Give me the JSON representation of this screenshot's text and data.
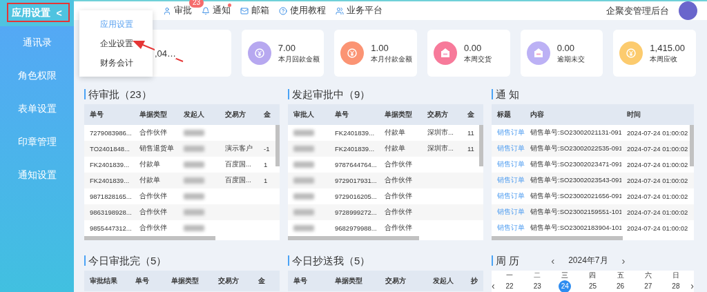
{
  "sidebar": {
    "title": "应用设置",
    "collapse_glyph": "<",
    "items": [
      {
        "label": "通讯录"
      },
      {
        "label": "角色权限"
      },
      {
        "label": "表单设置"
      },
      {
        "label": "印章管理"
      },
      {
        "label": "通知设置"
      }
    ]
  },
  "nav": [
    {
      "label": "审批",
      "badge": "23"
    },
    {
      "label": "通知",
      "dot": true
    },
    {
      "label": "邮箱"
    },
    {
      "label": "使用教程"
    },
    {
      "label": "业务平台"
    }
  ],
  "header_title": "企聚变管理后台",
  "dropdown": [
    {
      "label": "应用设置",
      "selected": true
    },
    {
      "label": "企业设置",
      "selected": false
    },
    {
      "label": "财务会计",
      "selected": false
    }
  ],
  "stats": [
    {
      "value": ",04…"
    },
    {
      "kind": "yen",
      "color": "#b7a8f0",
      "value": "7.00",
      "label": "本月回款金额"
    },
    {
      "kind": "yen",
      "color": "#fb9474",
      "value": "1.00",
      "label": "本月付款金额"
    },
    {
      "kind": "sale",
      "color": "#f77a9a",
      "value": "0.00",
      "label": "本周交货"
    },
    {
      "kind": "sale",
      "color": "#bcb1f5",
      "value": "0.00",
      "label": "逾期未交"
    },
    {
      "kind": "yen",
      "color": "#fccb6e",
      "value": "1,415.00",
      "label": "本周应收"
    }
  ],
  "panels": [
    {
      "title": "待审批（23）",
      "columns": [
        "单号",
        "单据类型",
        "发起人",
        "交易方",
        "金"
      ],
      "rows": [
        [
          "7279083986...",
          "合作伙伴",
          {
            "kind": "blurred"
          },
          "",
          ""
        ],
        [
          "TO2401848...",
          "销售退货单",
          {
            "kind": "blurred"
          },
          "演示客户",
          "-1"
        ],
        [
          "FK2401839...",
          "付款单",
          {
            "kind": "blurred"
          },
          "百度国...",
          "1"
        ],
        [
          "FK2401839...",
          "付款单",
          {
            "kind": "blurred"
          },
          "百度国...",
          "1"
        ],
        [
          "9871828165...",
          "合作伙伴",
          {
            "kind": "blurred"
          },
          "",
          ""
        ],
        [
          "9863198928...",
          "合作伙伴",
          {
            "kind": "blurred"
          },
          "",
          ""
        ],
        [
          "9855447312...",
          "合作伙伴",
          {
            "kind": "blurred"
          },
          "",
          ""
        ]
      ]
    },
    {
      "title": "发起审批中（9）",
      "columns": [
        "审批人",
        "单号",
        "单据类型",
        "交易方",
        "金"
      ],
      "rows": [
        [
          {
            "kind": "blurred"
          },
          "FK2401839...",
          "付款单",
          "深圳市...",
          "11"
        ],
        [
          {
            "kind": "blurred"
          },
          "FK2401839...",
          "付款单",
          "深圳市...",
          "11"
        ],
        [
          {
            "kind": "blurred"
          },
          "9787644764...",
          "合作伙伴",
          "",
          ""
        ],
        [
          {
            "kind": "blurred"
          },
          "9729017931...",
          "合作伙伴",
          "",
          ""
        ],
        [
          {
            "kind": "blurred"
          },
          "9729016205...",
          "合作伙伴",
          "",
          ""
        ],
        [
          {
            "kind": "blurred"
          },
          "9728999272...",
          "合作伙伴",
          "",
          ""
        ],
        [
          {
            "kind": "blurred"
          },
          "9682979988...",
          "合作伙伴",
          "",
          ""
        ]
      ]
    },
    {
      "title": "通 知",
      "columns": [
        "标题",
        "内容",
        "时间"
      ],
      "rows": [
        [
          "销售订单",
          "销售单号:SO23002021131-091",
          "2024-07-24 01:00:02"
        ],
        [
          "销售订单",
          "销售单号:SO23002022535-091",
          "2024-07-24 01:00:02"
        ],
        [
          "销售订单",
          "销售单号:SO23002023471-091",
          "2024-07-24 01:00:02"
        ],
        [
          "销售订单",
          "销售单号:SO23002023543-091",
          "2024-07-24 01:00:02"
        ],
        [
          "销售订单",
          "销售单号:SO23002021656-091",
          "2024-07-24 01:00:02"
        ],
        [
          "销售订单",
          "销售单号:SO23002159551-101",
          "2024-07-24 01:00:02"
        ],
        [
          "销售订单",
          "销售单号:SO23002183904-101",
          "2024-07-24 01:00:02"
        ]
      ]
    }
  ],
  "bottom_panels": [
    {
      "title": "今日审批完（5）",
      "columns": [
        "审批结果",
        "单号",
        "单据类型",
        "交易方",
        "金"
      ]
    },
    {
      "title": "今日抄送我（5）",
      "columns": [
        "单号",
        "单据类型",
        "交易方",
        "发起人",
        "抄"
      ]
    }
  ],
  "calendar": {
    "title": "周 历",
    "prev": "‹",
    "month": "2024年7月",
    "next": "›",
    "weekdays": [
      "一",
      "二",
      "三",
      "四",
      "五",
      "六",
      "日"
    ],
    "week_prev": "‹",
    "week_next": "›",
    "days": [
      {
        "label": "22",
        "selected": false
      },
      {
        "label": "23",
        "selected": false
      },
      {
        "label": "24",
        "selected": true
      },
      {
        "label": "25",
        "selected": false
      },
      {
        "label": "26",
        "selected": false
      },
      {
        "label": "27",
        "selected": false
      },
      {
        "label": "28",
        "selected": false
      }
    ]
  }
}
